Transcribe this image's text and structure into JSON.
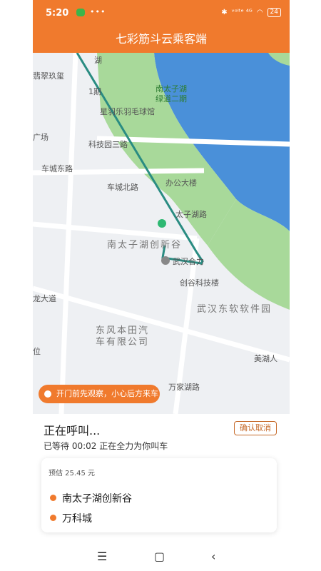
{
  "status": {
    "time": "5:20",
    "dots": "•••",
    "signal": "ᵛᵒˡᵗᵉ ⁴ᴳ",
    "battery": "24"
  },
  "app_title": "七彩筋斗云乘客端",
  "map_labels": {
    "feicui": "翡翠玖玺",
    "phase1": "1期",
    "lake_park": "南太子湖",
    "lake_park2": "绿道二期",
    "badminton": "星羽乐羽毛球馆",
    "plaza": "广场",
    "keji_road3": "科技园三路",
    "chechengdong": "车城东路",
    "office": "办公大楼",
    "chechengbei": "车城北路",
    "taizihu_road": "太子湖路",
    "checheng_west": "车城东路",
    "innovation_valley": "南太子湖创新谷",
    "wuhan_he": "武汉合力",
    "chuanggu": "创谷科技楼",
    "longdadao": "龙大道",
    "software_park": "武汉东软软件园",
    "honda1": "东风本田汽",
    "honda2": "车有限公司",
    "wei": "位",
    "meihu": "美湖人",
    "wanjia": "万家湖路",
    "top_road": "湖"
  },
  "tip": "开门前先观察，小心后方来车",
  "calling_text": "正在呼叫...",
  "cancel_label": "确认取消",
  "waiting_text": "已等待 00:02 正在全力为你叫车",
  "estimate": "预估 25.45 元",
  "pickup": "南太子湖创新谷",
  "dropoff": "万科城",
  "nav": {
    "menu": "☰",
    "home": "▢",
    "back": "‹"
  },
  "colors": {
    "accent": "#F07A2D",
    "water": "#4A90D9",
    "park": "#A8D99A",
    "route": "#2A8C82"
  }
}
